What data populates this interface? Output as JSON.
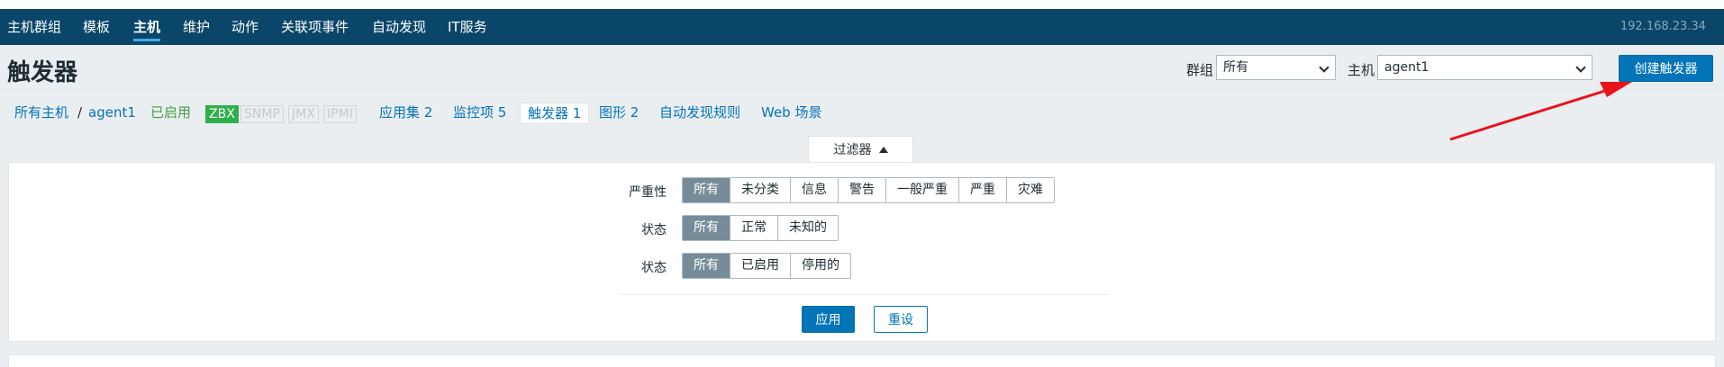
{
  "nav": {
    "items": [
      {
        "label": "主机群组",
        "active": false
      },
      {
        "label": "模板",
        "active": false
      },
      {
        "label": "主机",
        "active": true
      },
      {
        "label": "维护",
        "active": false
      },
      {
        "label": "动作",
        "active": false
      },
      {
        "label": "关联项事件",
        "active": false
      },
      {
        "label": "自动发现",
        "active": false
      },
      {
        "label": "IT服务",
        "active": false
      }
    ],
    "server_ip": "192.168.23.34"
  },
  "header": {
    "title": "触发器",
    "group_label": "群组",
    "group_value": "所有",
    "host_label": "主机",
    "host_value": "agent1",
    "create_button": "创建触发器"
  },
  "subnav": {
    "all_hosts": "所有主机",
    "separator": "/",
    "host": "agent1",
    "status": "已启用",
    "badges": {
      "zbx": "ZBX",
      "snmp": "SNMP",
      "jmx": "JMX",
      "ipmi": "IPMI"
    },
    "applications": "应用集 2",
    "items": "监控项 5",
    "triggers": "触发器 1",
    "graphs": "图形 2",
    "discovery_rules": "自动发现规则",
    "web_scenarios": "Web 场景"
  },
  "filter": {
    "tab_label": "过滤器",
    "severity_label": "严重性",
    "severity_options": [
      "所有",
      "未分类",
      "信息",
      "警告",
      "一般严重",
      "严重",
      "灾难"
    ],
    "severity_selected": "所有",
    "state_label": "状态",
    "state_options": [
      "所有",
      "正常",
      "未知的"
    ],
    "state_selected": "所有",
    "status_label": "状态",
    "status_options": [
      "所有",
      "已启用",
      "停用的"
    ],
    "status_selected": "所有",
    "apply_button": "应用",
    "reset_button": "重设"
  },
  "colors": {
    "nav_bg": "#0a466a",
    "primary": "#0275b8",
    "selected_segment": "#768d99",
    "enabled_green": "#429e47",
    "badge_green": "#2db04a",
    "annotation_arrow": "#e8141c"
  }
}
